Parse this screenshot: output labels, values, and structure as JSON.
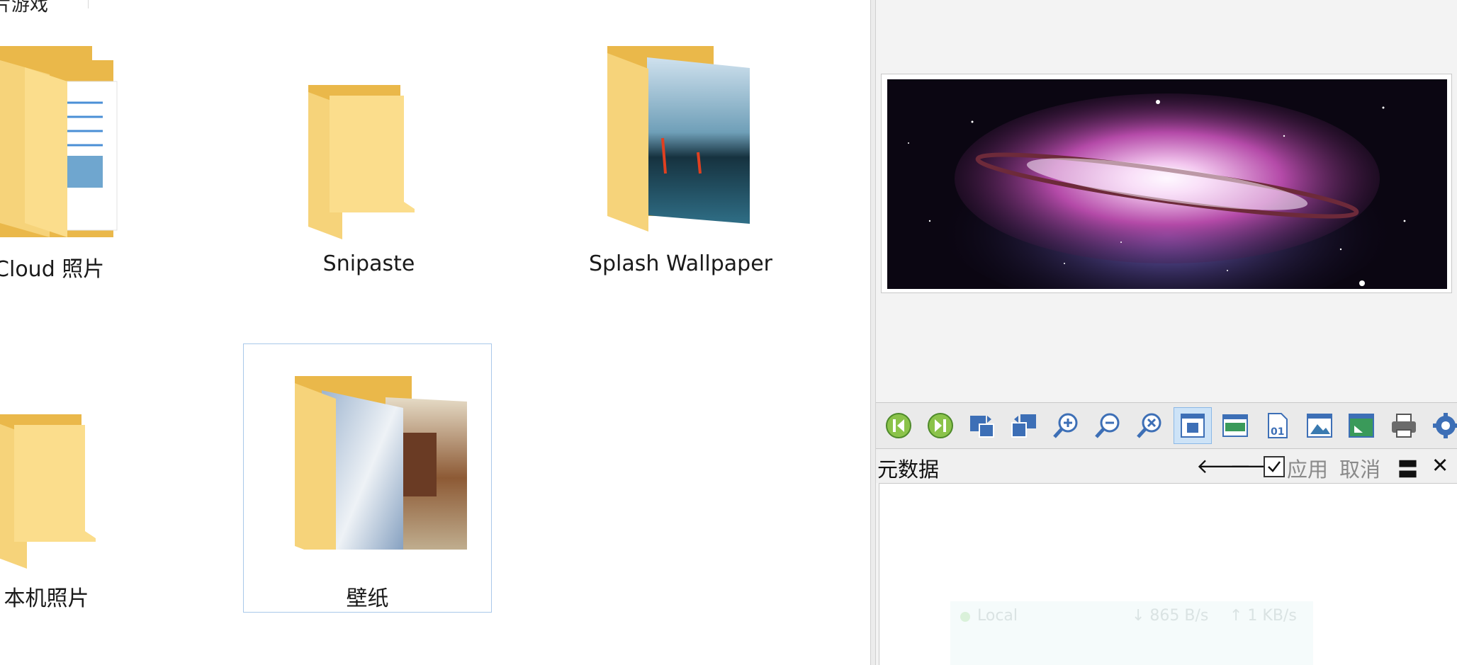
{
  "explorer": {
    "top_fragment": "片游戏",
    "folders": [
      {
        "label": "iCloud 照片",
        "icon": "folder-with-documents-icon"
      },
      {
        "label": "Snipaste",
        "icon": "folder-icon"
      },
      {
        "label": "Splash Wallpaper",
        "icon": "folder-with-image-icon"
      },
      {
        "label": "本机照片",
        "icon": "folder-icon"
      },
      {
        "label": "壁纸",
        "icon": "folder-with-images-icon",
        "selected": true
      }
    ]
  },
  "viewer": {
    "preview_icon": "galaxy-image-preview",
    "toolbar": [
      {
        "icon": "previous-icon"
      },
      {
        "icon": "next-icon"
      },
      {
        "icon": "rotate-left-icon"
      },
      {
        "icon": "rotate-right-icon"
      },
      {
        "icon": "zoom-in-icon"
      },
      {
        "icon": "zoom-out-icon"
      },
      {
        "icon": "zoom-reset-icon"
      },
      {
        "icon": "fit-window-icon",
        "active": true
      },
      {
        "icon": "fit-width-icon"
      },
      {
        "icon": "actual-size-icon"
      },
      {
        "icon": "stretch-icon"
      },
      {
        "icon": "fullscreen-icon"
      },
      {
        "icon": "print-icon"
      },
      {
        "icon": "settings-icon"
      }
    ],
    "metadata": {
      "title": "元数据",
      "prev_arrow": "🡐",
      "next_arrow": "🡒",
      "apply_label": "应用",
      "cancel_label": "取消",
      "menu_glyph": "〓",
      "close_glyph": "✕",
      "apply_checked": true
    },
    "ghost_widget": {
      "name": "Local",
      "down": "↓ 865 B/s",
      "up": "↑ 1 KB/s"
    }
  },
  "colors": {
    "folder_back": "#f2c94c",
    "folder_front": "#fbd97a",
    "selection_border": "#a9c8ea",
    "toolbar_icon_green": "#6aa84f",
    "toolbar_icon_blue": "#3d6fb6"
  }
}
